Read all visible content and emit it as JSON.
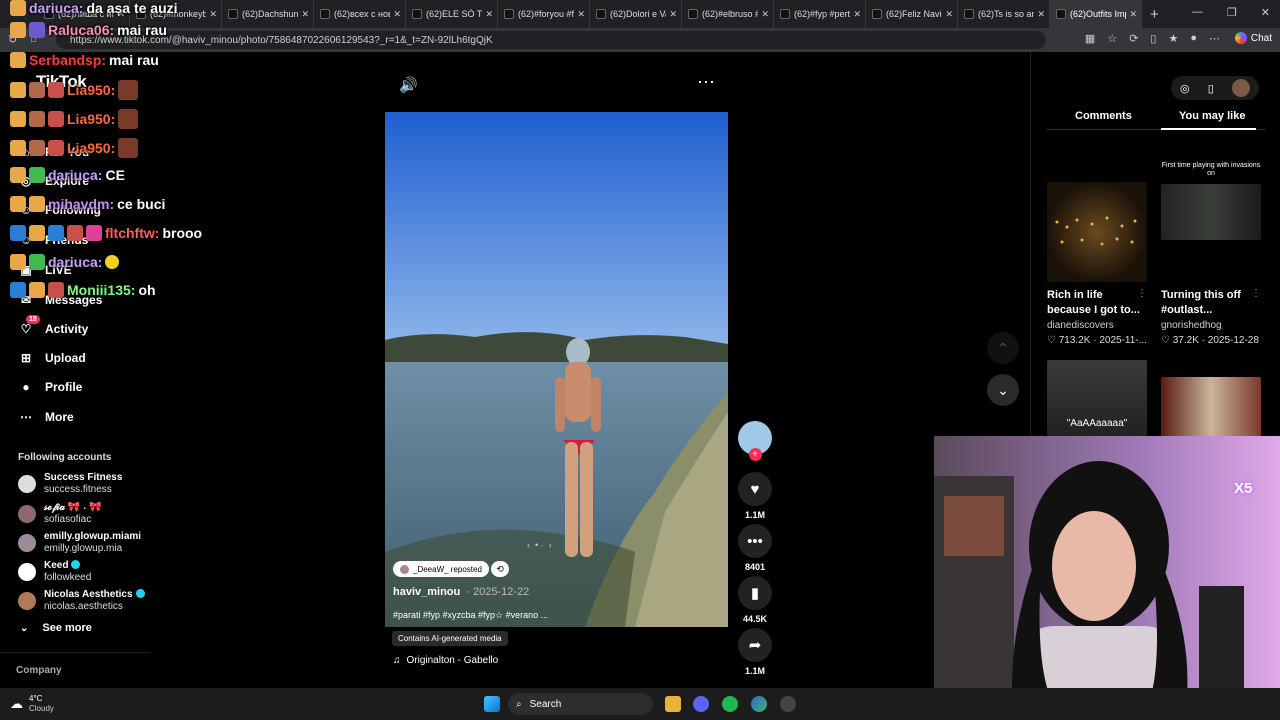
{
  "browser": {
    "tabs": [
      {
        "title": "(62)Лиша с игр",
        "active": false
      },
      {
        "title": "(62)#monkeyb",
        "active": false
      },
      {
        "title": "(62)Dachshund",
        "active": false
      },
      {
        "title": "(62)всех с новы",
        "active": false
      },
      {
        "title": "(62)ELE SÓ TINI",
        "active": false
      },
      {
        "title": "(62)#foryou #fy",
        "active": false
      },
      {
        "title": "(62)Dolori e Val",
        "active": false
      },
      {
        "title": "(62)#elbruso #",
        "active": false
      },
      {
        "title": "(62)#fyp #perte",
        "active": false
      },
      {
        "title": "(62)Feliz Navid",
        "active": false
      },
      {
        "title": "(62)Ts is so ann",
        "active": false
      },
      {
        "title": "(62)Outfits Imp",
        "active": true
      }
    ],
    "url": "https://www.tiktok.com/@haviv_minou/photo/7586487022606129543?_r=1&_t=ZN-92lLh6tgQjK",
    "chat_button": "Chat"
  },
  "overlay_chat": [
    {
      "user": "dariuca:",
      "msg": "da așa te auzi",
      "color": "#c9a0ff"
    },
    {
      "user": "Raluca06:",
      "msg": "mai rau",
      "color": "#ff8fb0"
    },
    {
      "user": "Serbandsp:",
      "msg": "mai rau",
      "color": "#ff3b3b"
    },
    {
      "user": "Lia950:",
      "msg": "",
      "color": "#ff6a3d"
    },
    {
      "user": "Lia950:",
      "msg": "",
      "color": "#ff6a3d"
    },
    {
      "user": "Lia950:",
      "msg": "",
      "color": "#ff6a3d"
    },
    {
      "user": "dariuca:",
      "msg": "CE",
      "color": "#c9a0ff"
    },
    {
      "user": "mihavdm:",
      "msg": "ce buci",
      "color": "#c98bff"
    },
    {
      "user": "fltchftw:",
      "msg": "brooo",
      "color": "#ff5e5e"
    },
    {
      "user": "dariuca:",
      "msg": "",
      "color": "#c9a0ff"
    },
    {
      "user": "Moniii135:",
      "msg": "oh",
      "color": "#7dff7d"
    }
  ],
  "sidebar": {
    "logo": "TikTok",
    "nav": [
      {
        "label": "For You",
        "icon": "home-icon"
      },
      {
        "label": "Explore",
        "icon": "compass-icon"
      },
      {
        "label": "Following",
        "icon": "following-icon"
      },
      {
        "label": "Friends",
        "icon": "friends-icon"
      },
      {
        "label": "LIVE",
        "icon": "live-icon"
      },
      {
        "label": "Messages",
        "icon": "messages-icon"
      },
      {
        "label": "Activity",
        "icon": "activity-icon",
        "badge": "18"
      },
      {
        "label": "Upload",
        "icon": "upload-icon"
      },
      {
        "label": "Profile",
        "icon": "profile-icon"
      },
      {
        "label": "More",
        "icon": "more-icon"
      }
    ],
    "following_title": "Following accounts",
    "accounts": [
      {
        "name": "Success Fitness",
        "handle": "success.fitness",
        "verified": false
      },
      {
        "name": "𝓈ℴ𝒻𝒾𝒶 🎀 ˖ 🎀",
        "handle": "sofiasofiac",
        "verified": false
      },
      {
        "name": "emilly.glowup.miami",
        "handle": "emilly.glowup.mia",
        "verified": false
      },
      {
        "name": "Keed",
        "handle": "followkeed",
        "verified": true
      },
      {
        "name": "Nicolas Aesthetics",
        "handle": "nicolas.aesthetics",
        "verified": true
      }
    ],
    "see_more": "See more",
    "company": "Company"
  },
  "post": {
    "repost_label": "_DeeaW_ reposted",
    "author": "haviv_minou",
    "date": "· 2025-12-22",
    "caption": "#parati #fyp #xyzcba #fyp☆ #verano ...",
    "ai_label": "Contains AI-generated media",
    "music": "Originalton - Gabello",
    "likes": "1.1M",
    "comments": "8401",
    "saves": "44.5K",
    "shares": "1.1M"
  },
  "right_panel": {
    "tabs": [
      "Comments",
      "You may like"
    ],
    "active_tab": "You may like",
    "cards": [
      {
        "overlay": "",
        "title": "Rich in life because I got to...",
        "user": "dianediscovers",
        "likes": "713.2K",
        "date": "2025-11-..."
      },
      {
        "overlay": "First time playing with invasions on",
        "title": "Turning this off #outlast...",
        "user": "gnorishedhog",
        "likes": "37.2K",
        "date": "2025-12-28"
      },
      {
        "overlay": "\"AaAAaaaaa\"",
        "title": "",
        "user": "",
        "likes": "",
        "date": ""
      },
      {
        "overlay": "",
        "title": "",
        "user": "",
        "likes": "",
        "date": ""
      }
    ]
  },
  "webcam": {
    "sub_badge": "X5"
  },
  "taskbar": {
    "weather_temp": "4°C",
    "weather_desc": "Cloudy",
    "search": "Search"
  }
}
